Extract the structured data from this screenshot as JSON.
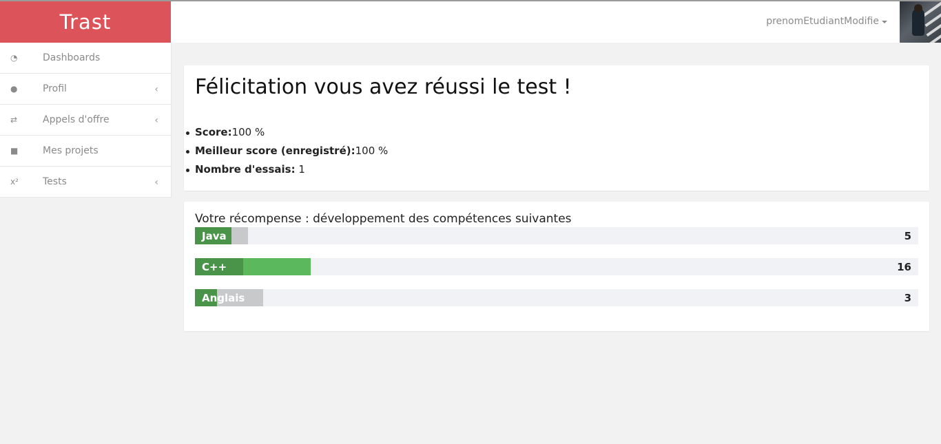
{
  "brand": {
    "name": "Trast",
    "color": "#dc5359"
  },
  "header": {
    "username": "prenomEtudiantModifie",
    "avatar_icon": "user-photo"
  },
  "sidebar": {
    "items": [
      {
        "label": "Dashboards",
        "icon": "dashboard-icon",
        "glyph": "◔",
        "submenu": false
      },
      {
        "label": "Profil",
        "icon": "user-icon",
        "glyph": "●",
        "submenu": true
      },
      {
        "label": "Appels d'offre",
        "icon": "exchange-icon",
        "glyph": "⇄",
        "submenu": true
      },
      {
        "label": "Mes projets",
        "icon": "briefcase-icon",
        "glyph": "■",
        "submenu": false
      },
      {
        "label": "Tests",
        "icon": "superscript-icon",
        "glyph": "x²",
        "submenu": true
      }
    ],
    "chevron": "‹"
  },
  "result": {
    "title": "Félicitation vous avez réussi le test !",
    "score_label": "Score:",
    "score_value": "100 %",
    "best_label": "Meilleur score (enregistré):",
    "best_value": "100 %",
    "attempts_label": "Nombre d'essais:",
    "attempts_value": "1"
  },
  "reward": {
    "title": "Votre récompense : développement des compétences suivantes",
    "max_points": 100,
    "skills": [
      {
        "name": "Java",
        "value": "5",
        "gained_fraction": 0.05,
        "total_fraction": 0.073,
        "bar_color": "#c8c9cb"
      },
      {
        "name": "C++",
        "value": "16",
        "gained_fraction": 0.067,
        "total_fraction": 0.16,
        "bar_color": "#5cb85c"
      },
      {
        "name": "Anglais",
        "value": "3",
        "gained_fraction": 0.03,
        "total_fraction": 0.094,
        "bar_color": "#c8c9cb"
      }
    ],
    "gained_color": "#4a944a"
  }
}
